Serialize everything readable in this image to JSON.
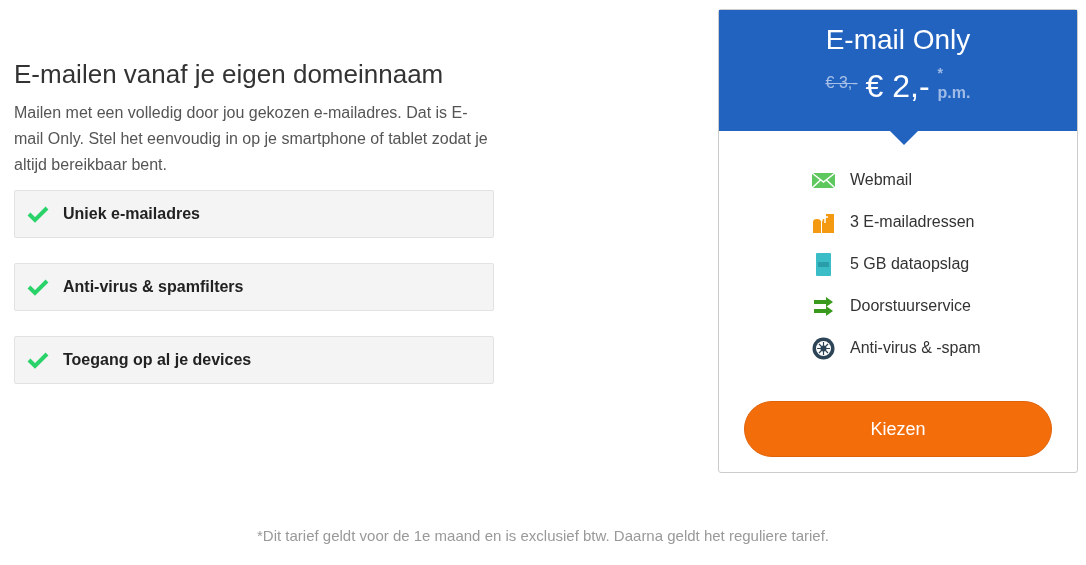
{
  "intro": {
    "title": "E-mailen vanaf je eigen domeinnaam",
    "text": "Mailen met een volledig door jou gekozen e-mailadres. Dat is E-mail Only. Stel het eenvoudig in op je smartphone of tablet zodat je altijd bereikbaar bent."
  },
  "benefits": [
    {
      "label": "Uniek e-mailadres"
    },
    {
      "label": "Anti-virus & spamfilters"
    },
    {
      "label": "Toegang op al je devices"
    }
  ],
  "plan": {
    "name": "E-mail Only",
    "old_price": "€ 3,-",
    "price": "€ 2,-",
    "asterisk": "*",
    "period": "p.m.",
    "features": [
      {
        "kind": "mail",
        "label": "Webmail"
      },
      {
        "kind": "mailbox",
        "label": "3 E-mailadressen"
      },
      {
        "kind": "ssd",
        "label": "5 GB dataopslag"
      },
      {
        "kind": "forward",
        "label": "Doorstuurservice"
      },
      {
        "kind": "virus",
        "label": "Anti-virus & -spam"
      }
    ],
    "button": "Kiezen"
  },
  "footnote": "*Dit tarief geldt voor de 1e maand en is exclusief btw. Daarna geldt het reguliere tarief."
}
